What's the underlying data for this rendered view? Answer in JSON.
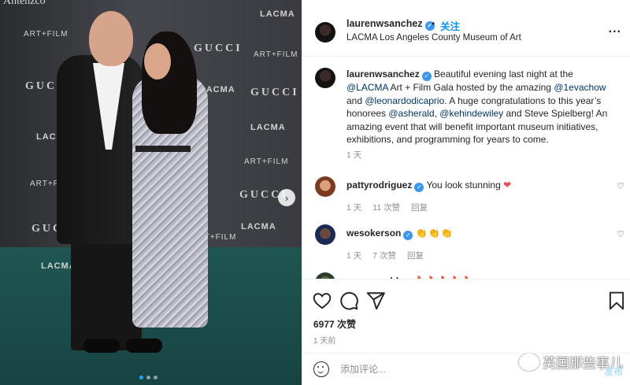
{
  "photo": {
    "watermark_top": "Antenzco",
    "logos": [
      "ART+FILM",
      "GUCCI",
      "LACMA"
    ],
    "nav_next": "›",
    "carousel_dots": 3,
    "carousel_active": 1
  },
  "header": {
    "username": "laurenwsanchez",
    "follow_label": "关注",
    "dot": "•",
    "location": "LACMA Los Angeles County Museum of Art",
    "more_label": "..."
  },
  "caption": {
    "username": "laurenwsanchez",
    "text_1": " Beautiful evening last night at the ",
    "mention_lacma": "@LACMA",
    "text_2": " Art + Film Gala hosted by the amazing ",
    "mention_eva": "@1evachow",
    "text_3": " and ",
    "mention_leo": "@leonardodicaprio",
    "text_4": ". A huge congratulations to this year’s honorees ",
    "mention_asherald": "@asherald",
    "text_5": ", ",
    "mention_kehinde": "@kehindewiley",
    "text_6": " and Steve Spielberg! An amazing event that will benefit important museum initiatives, exhibitions, and programming for years to come.",
    "time": "1 天"
  },
  "comments": [
    {
      "username": "pattyrodriguez",
      "text": "You look stunning",
      "emoji": "❤",
      "time": "1 天",
      "likes": "11 次赞",
      "reply": "回复"
    },
    {
      "username": "wesokerson",
      "text": "",
      "emoji": "👏👏👏",
      "time": "1 天",
      "likes": "7 次赞",
      "reply": "回复"
    },
    {
      "username": "venyxworld",
      "text": "",
      "emoji": "🔥🔥🔥🔥🔥"
    }
  ],
  "actions": {
    "likes": "6977 次赞",
    "time_ago": "1 天前"
  },
  "watermark": "英国那些事儿",
  "compose": {
    "placeholder": "添加评论...",
    "post_label": "发布"
  },
  "colors": {
    "link_blue": "#0095f6",
    "verified_blue": "#3897f0",
    "heart_red": "#ed4956",
    "carpet_teal": "#1f5652"
  }
}
